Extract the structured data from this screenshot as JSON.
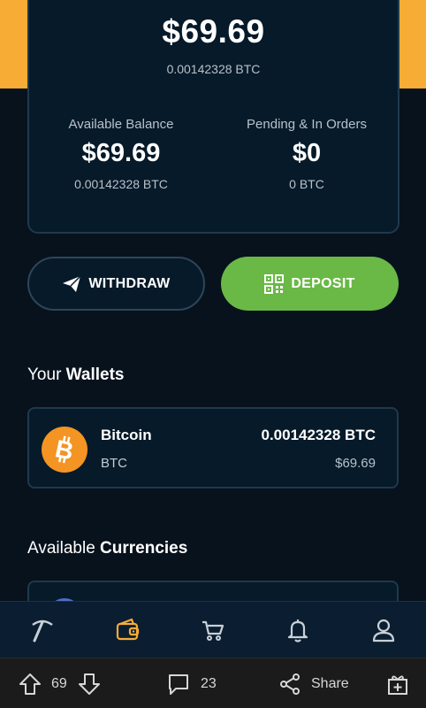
{
  "balance": {
    "total_usd": "$69.69",
    "total_btc": "0.00142328 BTC",
    "available": {
      "label": "Available Balance",
      "usd": "$69.69",
      "btc": "0.00142328 BTC"
    },
    "pending": {
      "label": "Pending & In Orders",
      "usd": "$0",
      "btc": "0 BTC"
    }
  },
  "actions": {
    "withdraw_label": "WITHDRAW",
    "deposit_label": "DEPOSIT"
  },
  "wallets": {
    "title_prefix": "Your",
    "title_bold": "Wallets",
    "items": [
      {
        "name": "Bitcoin",
        "code": "BTC",
        "amount": "0.00142328",
        "amount_unit": "BTC",
        "usd": "$69.69",
        "icon": "bitcoin-icon",
        "color": "#f39423"
      }
    ]
  },
  "currencies": {
    "title_prefix": "Available",
    "title_bold": "Currencies"
  },
  "bottom_nav": {
    "items": [
      "mining-icon",
      "wallet-icon",
      "cart-icon",
      "bell-icon",
      "profile-icon"
    ],
    "active": "wallet-icon",
    "active_color": "#f7ac36"
  },
  "reddit_bar": {
    "upvotes": "69",
    "comments": "23",
    "share_label": "Share"
  },
  "colors": {
    "accent_orange": "#f7ac36",
    "deposit_green": "#6ab946",
    "card_bg": "#061a29",
    "page_bg": "#07121d"
  }
}
